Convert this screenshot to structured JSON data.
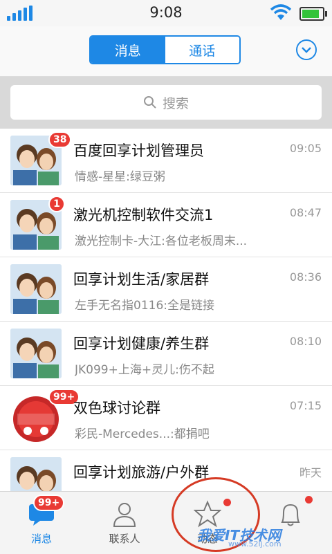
{
  "status_bar": {
    "time": "9:08"
  },
  "header": {
    "tabs": [
      {
        "label": "消息",
        "active": true
      },
      {
        "label": "通话",
        "active": false
      }
    ],
    "accent_color": "#1e88e5"
  },
  "search": {
    "placeholder": "搜索"
  },
  "conversations": [
    {
      "name": "百度回享计划管理员",
      "preview": "情感-星星:绿豆粥",
      "time": "09:05",
      "badge": "38",
      "avatar": "couple-avatar"
    },
    {
      "name": "激光机控制软件交流1",
      "preview": "激光控制卡-大江:各位老板周末...",
      "time": "08:47",
      "badge": "1",
      "avatar": "couple-avatar"
    },
    {
      "name": "回享计划生活/家居群",
      "preview": "左手无名指0116:全是链接",
      "time": "08:36",
      "badge": "",
      "avatar": "couple-avatar"
    },
    {
      "name": "回享计划健康/养生群",
      "preview": "JK099+上海+灵儿:伤不起",
      "time": "08:10",
      "badge": "",
      "avatar": "couple-avatar"
    },
    {
      "name": "双色球讨论群",
      "preview": "彩民-Mercedes...:都捐吧",
      "time": "07:15",
      "badge": "99+",
      "avatar": "lottery-avatar"
    },
    {
      "name": "回享计划旅游/户外群",
      "preview": "",
      "time": "昨天",
      "badge": "",
      "avatar": "couple-avatar"
    }
  ],
  "tabbar": {
    "items": [
      {
        "label": "消息",
        "badge": "99+",
        "icon": "chat-bubble-icon"
      },
      {
        "label": "联系人",
        "icon": "person-icon"
      },
      {
        "label": "动态",
        "icon": "star-icon"
      },
      {
        "label": "",
        "icon": "bell-icon"
      }
    ]
  },
  "watermark": {
    "text": "我爱IT技术网",
    "url": "www.52ij.com"
  }
}
